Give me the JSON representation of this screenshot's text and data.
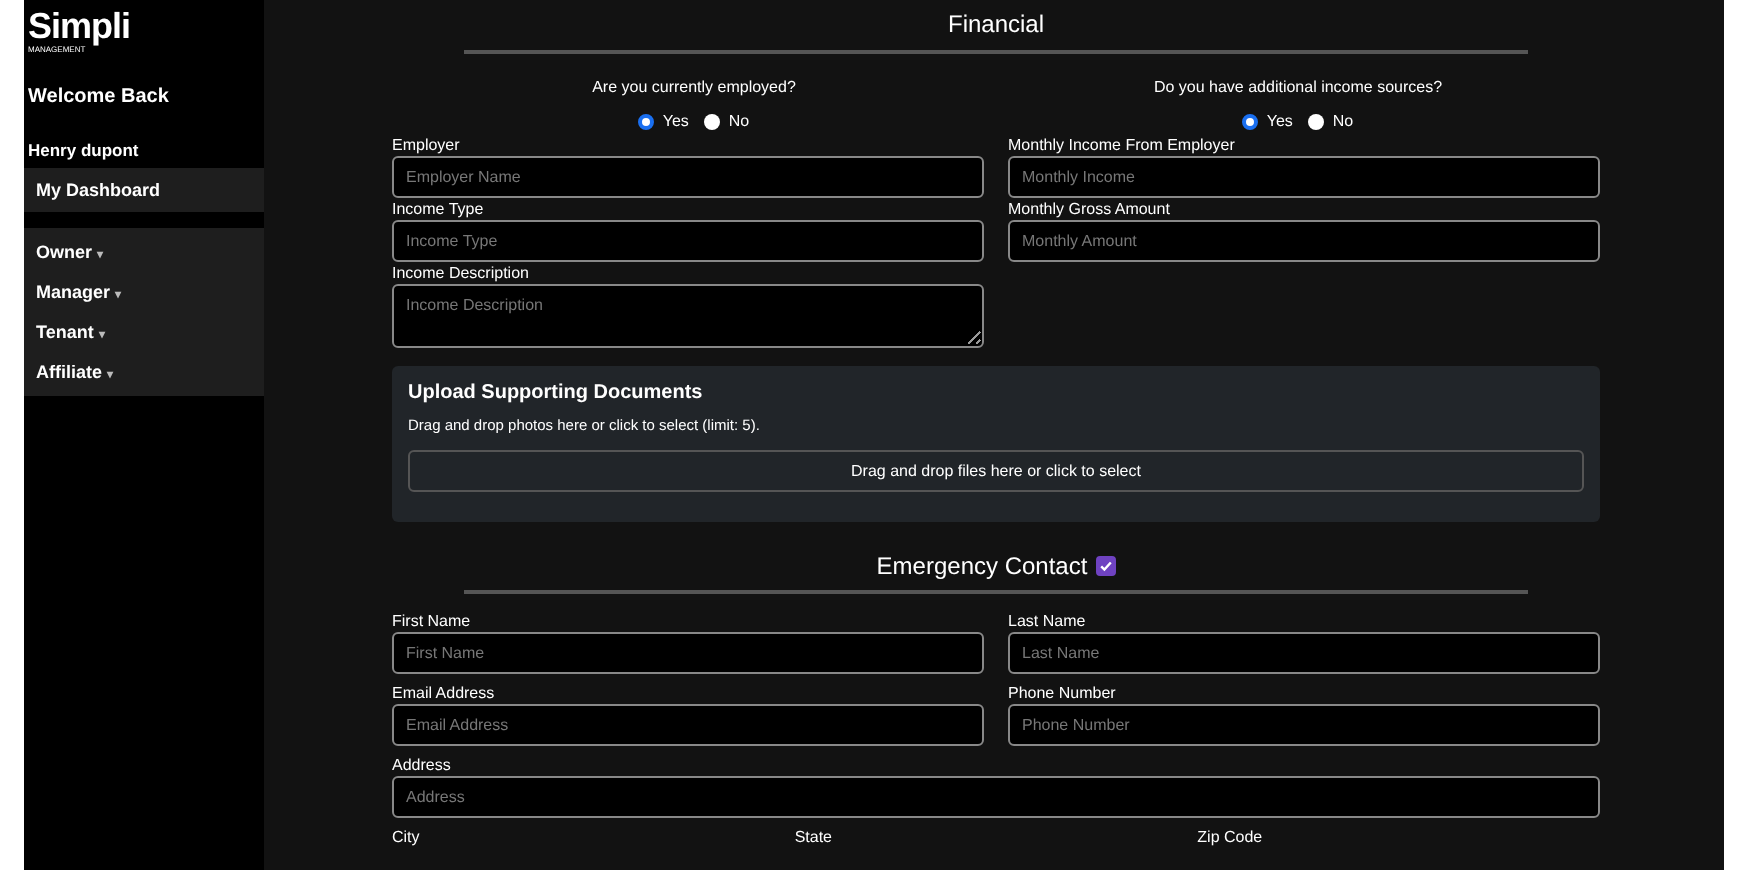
{
  "sidebar": {
    "logo": "Simpli",
    "logo_subtitle": "MANAGEMENT",
    "welcome": "Welcome Back",
    "user": "Henry dupont",
    "dashboard": {
      "label": "My Dashboard",
      "selected": true
    },
    "menus": [
      {
        "label": "Owner",
        "caret": "▾"
      },
      {
        "label": "Manager",
        "caret": "▾"
      },
      {
        "label": "Tenant",
        "caret": "▾"
      },
      {
        "label": "Affiliate",
        "caret": "▾"
      }
    ]
  },
  "financial": {
    "title": "Financial",
    "questions": [
      {
        "text": "Are you currently employed?",
        "options": [
          {
            "label": "Yes",
            "selected": true
          },
          {
            "label": "No",
            "selected": false
          }
        ]
      },
      {
        "text": "Do you have additional income sources?",
        "options": [
          {
            "label": "Yes",
            "selected": true
          },
          {
            "label": "No",
            "selected": false
          }
        ]
      }
    ],
    "fields": [
      {
        "label": "Employer",
        "placeholder": "Employer Name",
        "kind": "input"
      },
      {
        "label": "Monthly Income From Employer",
        "placeholder": "Monthly Income",
        "kind": "input"
      },
      {
        "label": "Income Type",
        "placeholder": "Income Type",
        "kind": "input"
      },
      {
        "label": "Monthly Gross Amount",
        "placeholder": "Monthly Amount",
        "kind": "input"
      },
      {
        "label": "Income Description",
        "placeholder": "Income Description",
        "kind": "textarea"
      }
    ]
  },
  "upload": {
    "title": "Upload Supporting Documents",
    "hint": "Drag and drop photos here or click to select (limit: 5).",
    "dropzone": "Drag and drop files here or click to select"
  },
  "emergency": {
    "title": "Emergency Contact",
    "checked": true,
    "fields": [
      {
        "label": "First Name",
        "placeholder": "First Name",
        "kind": "half"
      },
      {
        "label": "Last Name",
        "placeholder": "Last Name",
        "kind": "half"
      },
      {
        "label": "Email Address",
        "placeholder": "Email Address",
        "kind": "half"
      },
      {
        "label": "Phone Number",
        "placeholder": "Phone Number",
        "kind": "half"
      },
      {
        "label": "Address",
        "placeholder": "Address",
        "kind": "full"
      }
    ],
    "cut_labels": [
      "City",
      "State",
      "Zip Code"
    ]
  }
}
